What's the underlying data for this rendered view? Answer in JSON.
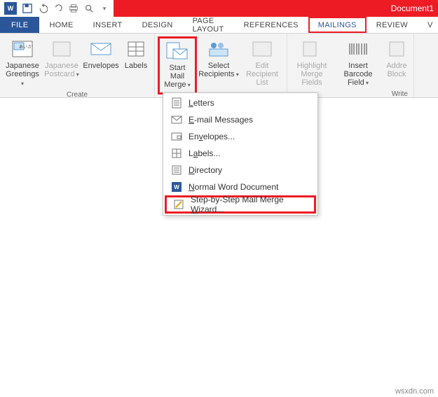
{
  "app": {
    "title": "Document1"
  },
  "qat": {
    "word_glyph": "W"
  },
  "tabs": {
    "file": "FILE",
    "home": "HOME",
    "insert": "INSERT",
    "design": "DESIGN",
    "pagelayout": "PAGE LAYOUT",
    "references": "REFERENCES",
    "mailings": "MAILINGS",
    "review": "REVIEW",
    "view": "V"
  },
  "ribbon": {
    "groups": {
      "create": "Create",
      "write": "Write"
    },
    "buttons": {
      "jpgreetings": "Japanese\nGreetings",
      "jppostcard": "Japanese\nPostcard",
      "envelopes": "Envelopes",
      "labels": "Labels",
      "startmail": "Start Mail\nMerge",
      "selectrcpts": "Select\nRecipients",
      "editrlist": "Edit\nRecipient List",
      "hlmerge": "Highlight\nMerge Fields",
      "insbarcode": "Insert Barcode\nField",
      "addrblock": "Addre\nBlock"
    }
  },
  "menu": {
    "letters": "Letters",
    "email": "E-mail Messages",
    "envelopes": "Envelopes...",
    "labels": "Labels...",
    "directory": "Directory",
    "normal": "Normal Word Document",
    "wizard": "Step-by-Step Mail Merge Wizard..."
  },
  "watermark": "wsxdn.com"
}
